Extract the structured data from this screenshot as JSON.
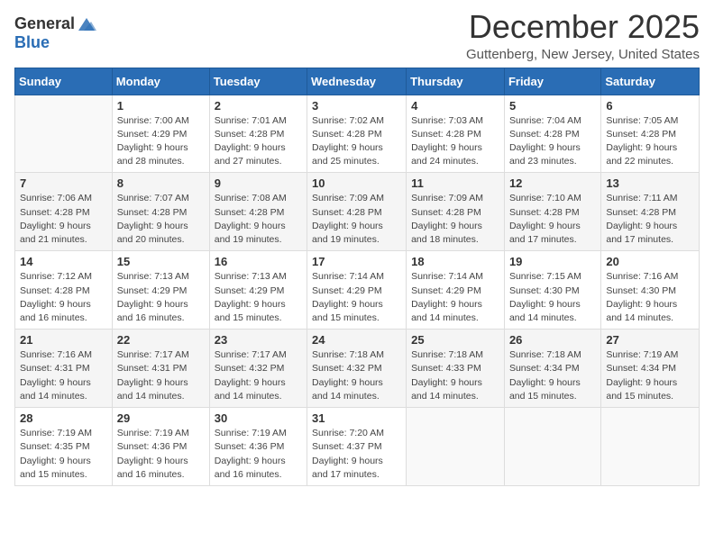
{
  "logo": {
    "general": "General",
    "blue": "Blue"
  },
  "title": "December 2025",
  "location": "Guttenberg, New Jersey, United States",
  "days_header": [
    "Sunday",
    "Monday",
    "Tuesday",
    "Wednesday",
    "Thursday",
    "Friday",
    "Saturday"
  ],
  "weeks": [
    [
      {
        "num": "",
        "info": ""
      },
      {
        "num": "1",
        "info": "Sunrise: 7:00 AM\nSunset: 4:29 PM\nDaylight: 9 hours\nand 28 minutes."
      },
      {
        "num": "2",
        "info": "Sunrise: 7:01 AM\nSunset: 4:28 PM\nDaylight: 9 hours\nand 27 minutes."
      },
      {
        "num": "3",
        "info": "Sunrise: 7:02 AM\nSunset: 4:28 PM\nDaylight: 9 hours\nand 25 minutes."
      },
      {
        "num": "4",
        "info": "Sunrise: 7:03 AM\nSunset: 4:28 PM\nDaylight: 9 hours\nand 24 minutes."
      },
      {
        "num": "5",
        "info": "Sunrise: 7:04 AM\nSunset: 4:28 PM\nDaylight: 9 hours\nand 23 minutes."
      },
      {
        "num": "6",
        "info": "Sunrise: 7:05 AM\nSunset: 4:28 PM\nDaylight: 9 hours\nand 22 minutes."
      }
    ],
    [
      {
        "num": "7",
        "info": "Sunrise: 7:06 AM\nSunset: 4:28 PM\nDaylight: 9 hours\nand 21 minutes."
      },
      {
        "num": "8",
        "info": "Sunrise: 7:07 AM\nSunset: 4:28 PM\nDaylight: 9 hours\nand 20 minutes."
      },
      {
        "num": "9",
        "info": "Sunrise: 7:08 AM\nSunset: 4:28 PM\nDaylight: 9 hours\nand 19 minutes."
      },
      {
        "num": "10",
        "info": "Sunrise: 7:09 AM\nSunset: 4:28 PM\nDaylight: 9 hours\nand 19 minutes."
      },
      {
        "num": "11",
        "info": "Sunrise: 7:09 AM\nSunset: 4:28 PM\nDaylight: 9 hours\nand 18 minutes."
      },
      {
        "num": "12",
        "info": "Sunrise: 7:10 AM\nSunset: 4:28 PM\nDaylight: 9 hours\nand 17 minutes."
      },
      {
        "num": "13",
        "info": "Sunrise: 7:11 AM\nSunset: 4:28 PM\nDaylight: 9 hours\nand 17 minutes."
      }
    ],
    [
      {
        "num": "14",
        "info": "Sunrise: 7:12 AM\nSunset: 4:28 PM\nDaylight: 9 hours\nand 16 minutes."
      },
      {
        "num": "15",
        "info": "Sunrise: 7:13 AM\nSunset: 4:29 PM\nDaylight: 9 hours\nand 16 minutes."
      },
      {
        "num": "16",
        "info": "Sunrise: 7:13 AM\nSunset: 4:29 PM\nDaylight: 9 hours\nand 15 minutes."
      },
      {
        "num": "17",
        "info": "Sunrise: 7:14 AM\nSunset: 4:29 PM\nDaylight: 9 hours\nand 15 minutes."
      },
      {
        "num": "18",
        "info": "Sunrise: 7:14 AM\nSunset: 4:29 PM\nDaylight: 9 hours\nand 14 minutes."
      },
      {
        "num": "19",
        "info": "Sunrise: 7:15 AM\nSunset: 4:30 PM\nDaylight: 9 hours\nand 14 minutes."
      },
      {
        "num": "20",
        "info": "Sunrise: 7:16 AM\nSunset: 4:30 PM\nDaylight: 9 hours\nand 14 minutes."
      }
    ],
    [
      {
        "num": "21",
        "info": "Sunrise: 7:16 AM\nSunset: 4:31 PM\nDaylight: 9 hours\nand 14 minutes."
      },
      {
        "num": "22",
        "info": "Sunrise: 7:17 AM\nSunset: 4:31 PM\nDaylight: 9 hours\nand 14 minutes."
      },
      {
        "num": "23",
        "info": "Sunrise: 7:17 AM\nSunset: 4:32 PM\nDaylight: 9 hours\nand 14 minutes."
      },
      {
        "num": "24",
        "info": "Sunrise: 7:18 AM\nSunset: 4:32 PM\nDaylight: 9 hours\nand 14 minutes."
      },
      {
        "num": "25",
        "info": "Sunrise: 7:18 AM\nSunset: 4:33 PM\nDaylight: 9 hours\nand 14 minutes."
      },
      {
        "num": "26",
        "info": "Sunrise: 7:18 AM\nSunset: 4:34 PM\nDaylight: 9 hours\nand 15 minutes."
      },
      {
        "num": "27",
        "info": "Sunrise: 7:19 AM\nSunset: 4:34 PM\nDaylight: 9 hours\nand 15 minutes."
      }
    ],
    [
      {
        "num": "28",
        "info": "Sunrise: 7:19 AM\nSunset: 4:35 PM\nDaylight: 9 hours\nand 15 minutes."
      },
      {
        "num": "29",
        "info": "Sunrise: 7:19 AM\nSunset: 4:36 PM\nDaylight: 9 hours\nand 16 minutes."
      },
      {
        "num": "30",
        "info": "Sunrise: 7:19 AM\nSunset: 4:36 PM\nDaylight: 9 hours\nand 16 minutes."
      },
      {
        "num": "31",
        "info": "Sunrise: 7:20 AM\nSunset: 4:37 PM\nDaylight: 9 hours\nand 17 minutes."
      },
      {
        "num": "",
        "info": ""
      },
      {
        "num": "",
        "info": ""
      },
      {
        "num": "",
        "info": ""
      }
    ]
  ]
}
